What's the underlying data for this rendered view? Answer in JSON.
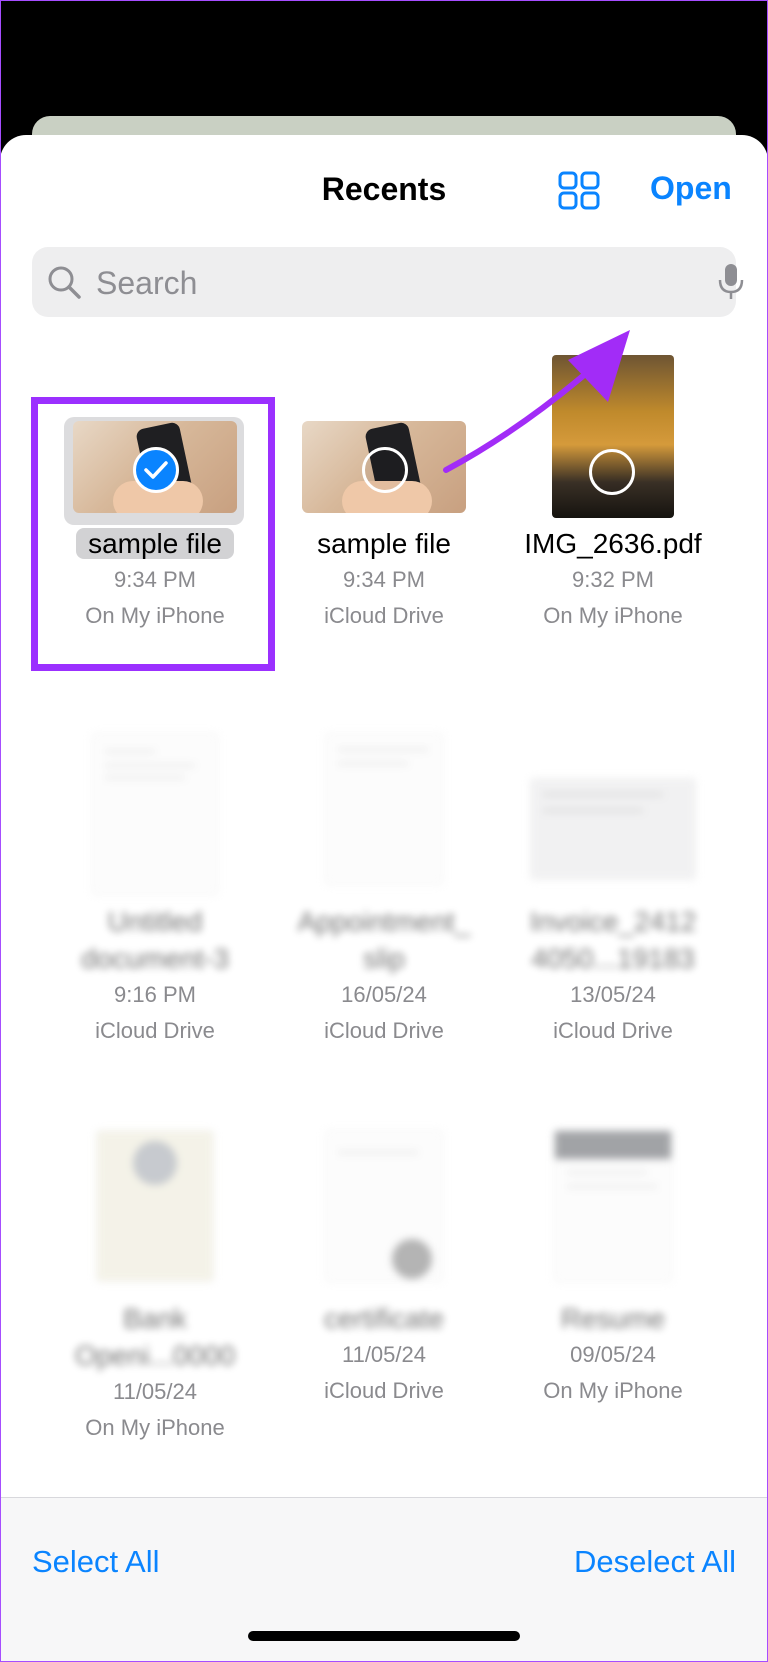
{
  "header": {
    "title": "Recents",
    "open_label": "Open"
  },
  "search": {
    "placeholder": "Search"
  },
  "files": [
    {
      "name": "sample file",
      "time": "9:34 PM",
      "location": "On My iPhone",
      "selected": true
    },
    {
      "name": "sample file",
      "time": "9:34 PM",
      "location": "iCloud Drive",
      "selected": false
    },
    {
      "name": "IMG_2636.pdf",
      "time": "9:32 PM",
      "location": "On My iPhone",
      "selected": false
    },
    {
      "name_line1": "Untitled",
      "name_line2": "document-3",
      "time": "9:16 PM",
      "location": "iCloud Drive"
    },
    {
      "name_line1": "Appointment_",
      "name_line2": "slip",
      "time": "16/05/24",
      "location": "iCloud Drive"
    },
    {
      "name_line1": "Invoice_2412",
      "name_line2": "4050...19183",
      "time": "13/05/24",
      "location": "iCloud Drive"
    },
    {
      "name_line1": "Bank",
      "name_line2": "Openi...0000",
      "time": "11/05/24",
      "location": "On My iPhone"
    },
    {
      "name_line1": "",
      "name_line2": "certificate",
      "time": "11/05/24",
      "location": "iCloud Drive"
    },
    {
      "name_line1": "",
      "name_line2": "Resume",
      "time": "09/05/24",
      "location": "On My iPhone"
    }
  ],
  "toolbar": {
    "select_all": "Select All",
    "deselect_all": "Deselect All"
  },
  "colors": {
    "accent": "#0a84ff",
    "highlight": "#9b30ff"
  }
}
